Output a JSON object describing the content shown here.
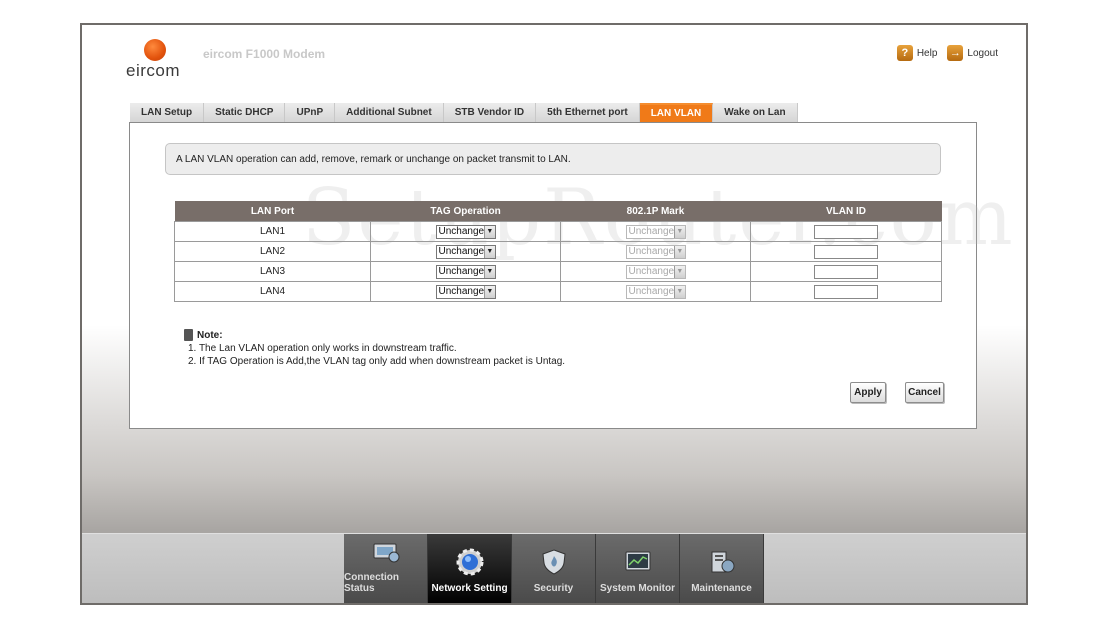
{
  "header": {
    "logo_text": "eircom",
    "model": "eircom F1000 Modem",
    "help_label": "Help",
    "logout_label": "Logout"
  },
  "tabs": [
    {
      "label": "LAN Setup",
      "active": false
    },
    {
      "label": "Static DHCP",
      "active": false
    },
    {
      "label": "UPnP",
      "active": false
    },
    {
      "label": "Additional Subnet",
      "active": false
    },
    {
      "label": "STB Vendor ID",
      "active": false
    },
    {
      "label": "5th Ethernet port",
      "active": false
    },
    {
      "label": "LAN VLAN",
      "active": true
    },
    {
      "label": "Wake on Lan",
      "active": false
    }
  ],
  "info_text": "A LAN VLAN operation can add, remove, remark or unchange on packet transmit to LAN.",
  "watermark": "SetupRouter.com",
  "table": {
    "headers": [
      "LAN Port",
      "TAG Operation",
      "802.1P Mark",
      "VLAN ID"
    ],
    "rows": [
      {
        "port": "LAN1",
        "tag_operation": "Unchange",
        "mark": "Unchange",
        "vlan_id": ""
      },
      {
        "port": "LAN2",
        "tag_operation": "Unchange",
        "mark": "Unchange",
        "vlan_id": ""
      },
      {
        "port": "LAN3",
        "tag_operation": "Unchange",
        "mark": "Unchange",
        "vlan_id": ""
      },
      {
        "port": "LAN4",
        "tag_operation": "Unchange",
        "mark": "Unchange",
        "vlan_id": ""
      }
    ]
  },
  "note": {
    "title": "Note:",
    "lines": [
      "1. The Lan VLAN operation only works in downstream traffic.",
      "2. If TAG Operation is Add,the VLAN tag only add when downstream packet is Untag."
    ]
  },
  "buttons": {
    "apply": "Apply",
    "cancel": "Cancel"
  },
  "bottom_nav": [
    {
      "label": "Connection Status",
      "icon": "connection-status-icon",
      "active": false
    },
    {
      "label": "Network Setting",
      "icon": "network-setting-icon",
      "active": true
    },
    {
      "label": "Security",
      "icon": "security-shield-icon",
      "active": false
    },
    {
      "label": "System Monitor",
      "icon": "system-monitor-icon",
      "active": false
    },
    {
      "label": "Maintenance",
      "icon": "maintenance-icon",
      "active": false
    }
  ],
  "colors": {
    "accent": "#f07a18",
    "table_header": "#786e69"
  }
}
